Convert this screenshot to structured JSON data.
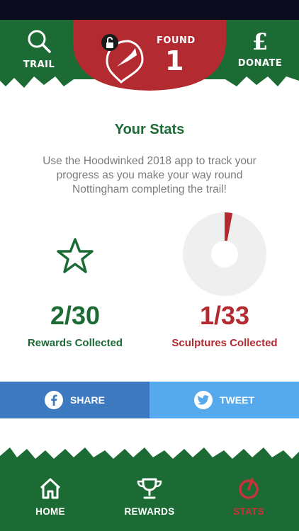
{
  "header": {
    "trail_label": "TRAIL",
    "found_label": "FOUND",
    "found_count": "1",
    "donate_label": "DONATE",
    "donate_symbol": "£"
  },
  "stats": {
    "title": "Your Stats",
    "description": "Use the Hoodwinked 2018 app to track your progress as you make your way round Nottingham completing the trail!",
    "rewards_value": "2/30",
    "rewards_label": "Rewards Collected",
    "sculptures_value": "1/33",
    "sculptures_label": "Sculptures Collected",
    "sculptures_collected": 1,
    "sculptures_total": 33
  },
  "share": {
    "share_label": "SHARE",
    "tweet_label": "TWEET"
  },
  "nav": {
    "home_label": "HOME",
    "rewards_label": "REWARDS",
    "stats_label": "STATS"
  },
  "colors": {
    "green": "#1c6b35",
    "red": "#b42a31",
    "facebook_blue": "#3c79be",
    "twitter_blue": "#57a9ed"
  }
}
